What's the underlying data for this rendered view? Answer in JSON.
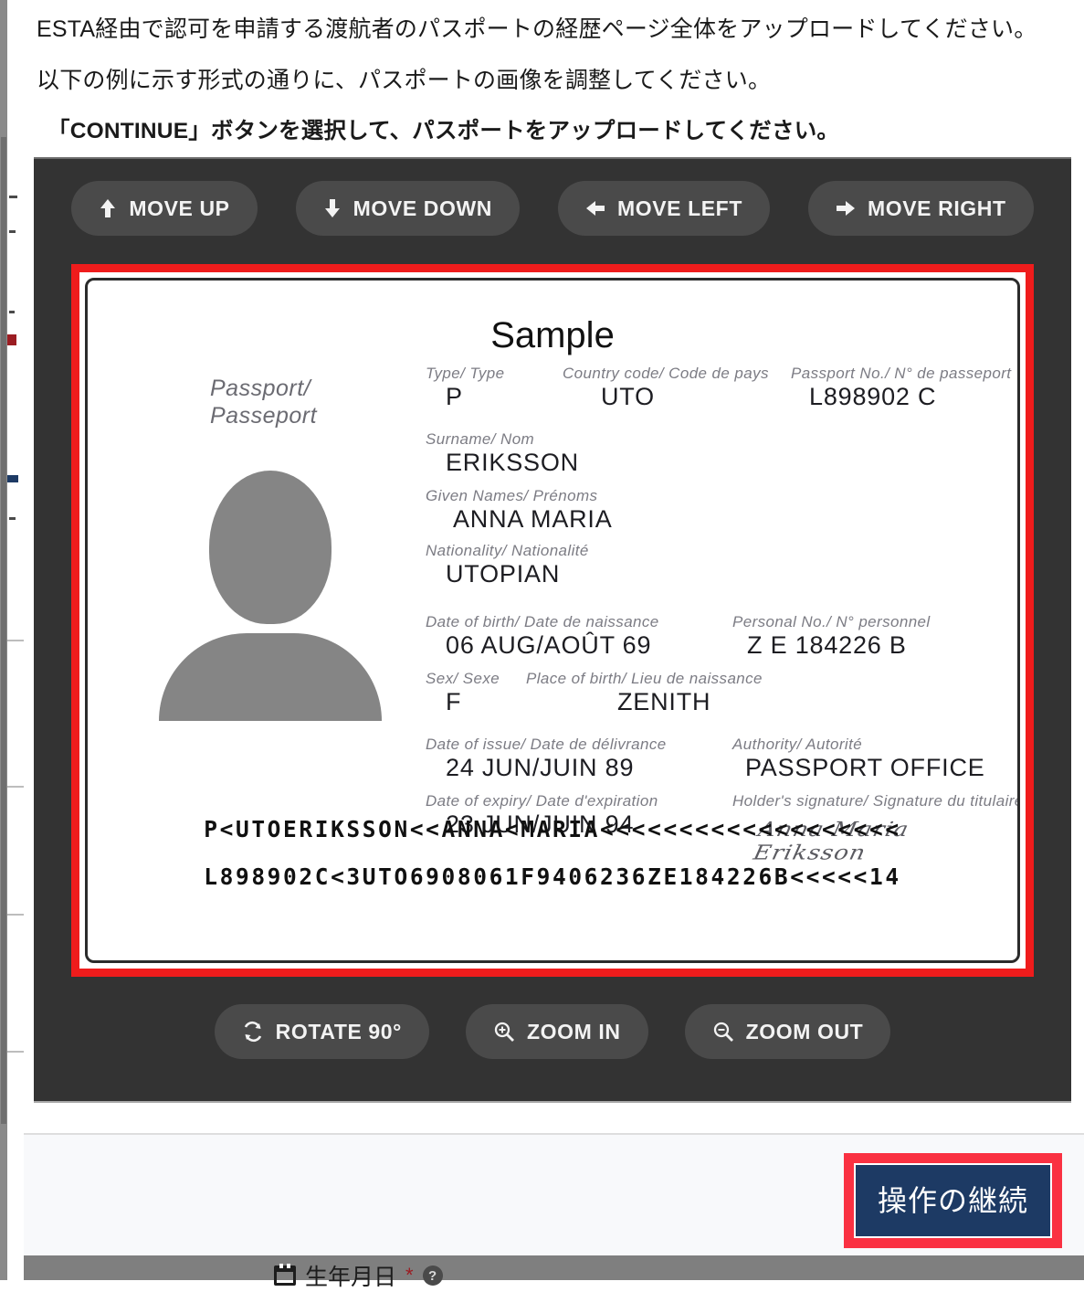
{
  "instructions": {
    "line1": "ESTA経由で認可を申請する渡航者のパスポートの経歴ページ全体をアップロードしてください。",
    "line2": "以下の例に示す形式の通りに、パスポートの画像を調整してください。",
    "line3": "「CONTINUE」ボタンを選択して、パスポートをアップロードしてください。"
  },
  "toolbar_top": [
    {
      "label": "MOVE UP",
      "icon": "arrow-up-icon"
    },
    {
      "label": "MOVE DOWN",
      "icon": "arrow-down-icon"
    },
    {
      "label": "MOVE LEFT",
      "icon": "arrow-left-icon"
    },
    {
      "label": "MOVE RIGHT",
      "icon": "arrow-right-icon"
    }
  ],
  "toolbar_bottom": [
    {
      "label": "ROTATE 90°",
      "icon": "rotate-icon"
    },
    {
      "label": "ZOOM IN",
      "icon": "magnifier-plus-icon"
    },
    {
      "label": "ZOOM OUT",
      "icon": "magnifier-minus-icon"
    }
  ],
  "passport": {
    "title": "Sample",
    "doc_label": "Passport/",
    "doc_label2": "Passeport",
    "fields": {
      "type_label": "Type/ Type",
      "type_value": "P",
      "country_code_label": "Country code/ Code de pays",
      "country_code_value": "UTO",
      "passport_no_label": "Passport No./ N° de passeport",
      "passport_no_value": "L898902 C",
      "surname_label": "Surname/ Nom",
      "surname_value": "ERIKSSON",
      "given_names_label": "Given Names/ Prénoms",
      "given_names_value": "ANNA MARIA",
      "nationality_label": "Nationality/ Nationalité",
      "nationality_value": "UTOPIAN",
      "dob_label": "Date of birth/ Date de naissance",
      "dob_value": "06 AUG/AOÛT 69",
      "personal_no_label": "Personal No./ N° personnel",
      "personal_no_value": "Z E 184226 B",
      "sex_label": "Sex/ Sexe",
      "sex_value": "F",
      "pob_label": "Place of birth/ Lieu de naissance",
      "pob_value": "ZENITH",
      "issue_label": "Date of issue/ Date de délivrance",
      "issue_value": "24 JUN/JUIN 89",
      "authority_label": "Authority/ Autorité",
      "authority_value": "PASSPORT OFFICE",
      "expiry_label": "Date of expiry/ Date d'expiration",
      "expiry_value": "23 JUN/JUIN 94",
      "signature_label": "Holder's signature/ Signature du titulaire",
      "signature_value": "Anna Maria Eriksson"
    },
    "mrz_line1": "P<UTOERIKSSON<<ANNA<MARIA<<<<<<<<<<<<<<<<<<<",
    "mrz_line2": "L898902C<3UTO6908061F9406236ZE184226B<<<<<14",
    "photo_icon": "person-silhouette-icon"
  },
  "footer": {
    "continue_label": "操作の継続"
  },
  "background_page": {
    "dob_label": "生年月日",
    "required_mark": "*",
    "help_icon": "question-mark-icon",
    "calendar_icon": "calendar-icon"
  },
  "colors": {
    "highlight_red": "#fa3142",
    "preview_border_red": "#ef1c1c",
    "editor_bg": "#333333",
    "button_navy": "#1d3a64",
    "toolbar_button": "#4a4a4a"
  }
}
